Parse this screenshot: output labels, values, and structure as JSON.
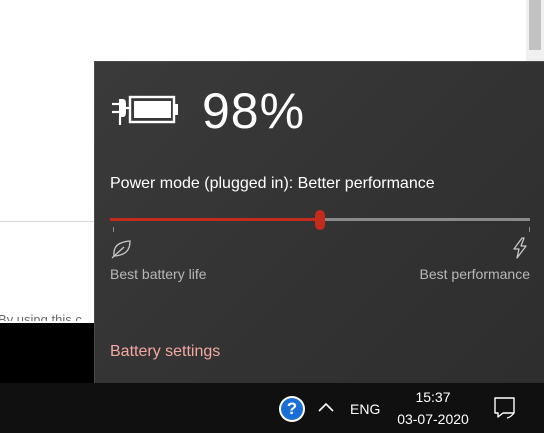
{
  "background": {
    "partial_text": "By using this c"
  },
  "flyout": {
    "battery_percent": "98%",
    "battery_level": 0.98,
    "charging": true,
    "power_mode_label": "Power mode (plugged in): Better performance",
    "slider_value": 0.5,
    "slider_min_label": "Best battery life",
    "slider_max_label": "Best performance",
    "settings_link": "Battery settings",
    "accent_color": "#c42b1c",
    "link_color": "#f2a9a1"
  },
  "taskbar": {
    "help_icon": "help-question-icon",
    "help_glyph": "?",
    "chevron_icon": "show-hidden-icons-chevron",
    "language": "ENG",
    "time": "15:37",
    "date": "03-07-2020",
    "notification_icon": "action-center-icon"
  }
}
